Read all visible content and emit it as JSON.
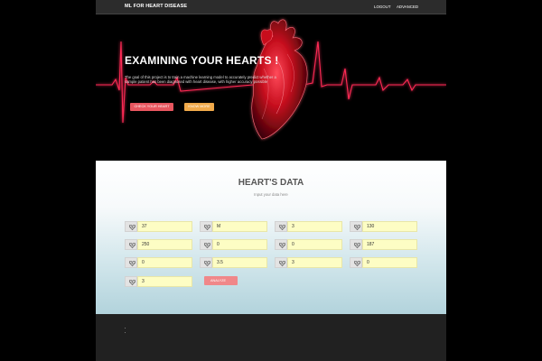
{
  "navbar": {
    "brand": "ML FOR HEART DISEASE",
    "links": [
      "LOGOUT",
      "ADVANCED"
    ]
  },
  "hero": {
    "title": "EXAMINING YOUR HEARTS !",
    "description": "The goal of this project is to train a machine learning model to accurately predict whether a sample patient has been diagnosed with heart disease, with higher accuracy possible",
    "buttons": {
      "check": "CHECK YOUR HEART",
      "know": "KNOW MORE"
    },
    "colors": {
      "pulse": "#ff2a55",
      "heart": "#d8102a"
    }
  },
  "data_section": {
    "title": "HEART'S DATA",
    "subtitle": "Input your data here",
    "fields": [
      "37",
      "M",
      "3",
      "130",
      "250",
      "0",
      "0",
      "187",
      "0",
      "3.5",
      "3",
      "0",
      "3"
    ],
    "field_icon": "heart-pulse-icon",
    "analyze_label": "ANALYZE",
    "colors": {
      "input_bg": "#fdfdc4",
      "analyze": "#f08789"
    }
  }
}
